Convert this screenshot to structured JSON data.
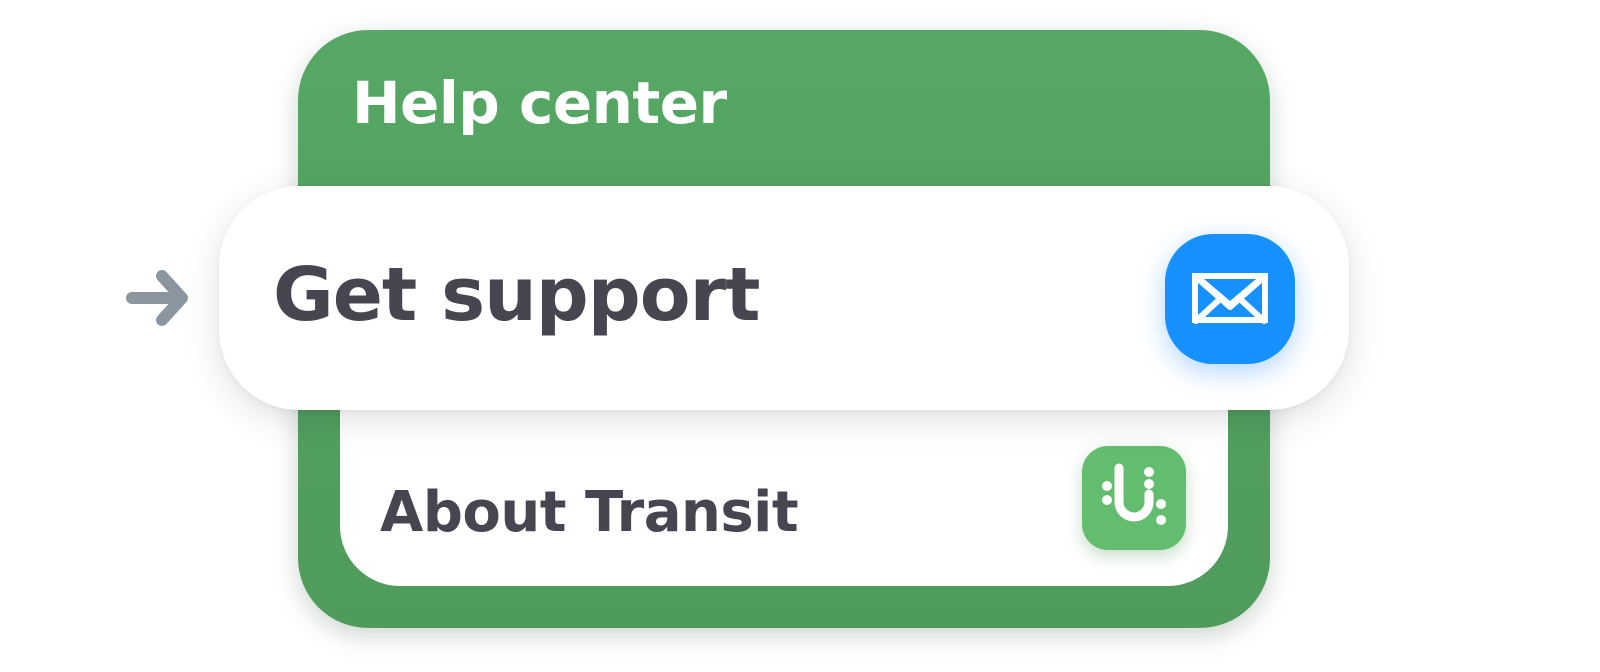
{
  "help_center": {
    "title": "Help center"
  },
  "menu": {
    "get_support": {
      "label": "Get support",
      "icon": "envelope-icon",
      "icon_bg": "#1691ff"
    },
    "about_transit": {
      "label": "About Transit",
      "icon": "transit-logo-icon",
      "icon_bg": "#63bd6e"
    }
  },
  "pointer": {
    "icon": "arrow-right-icon",
    "color": "#8c96a0"
  },
  "colors": {
    "card_green": "#53a462",
    "text_dark": "#45464f"
  }
}
